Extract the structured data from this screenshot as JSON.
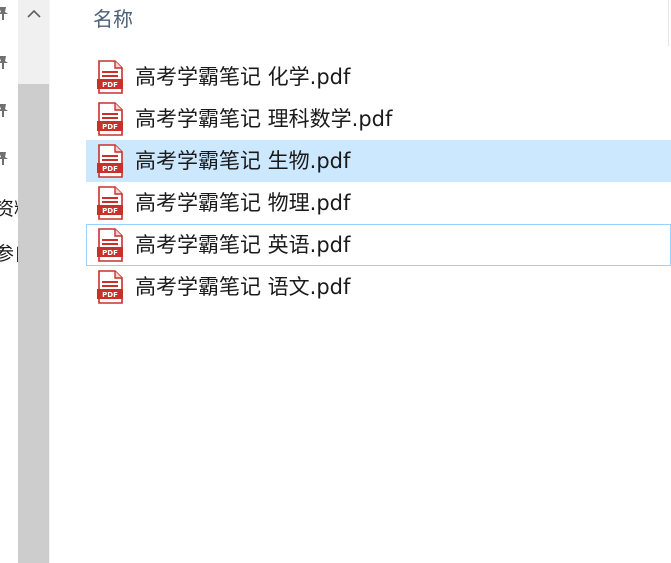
{
  "nav": {
    "partial_items": [
      {
        "text": "资料"
      },
      {
        "text": "参自"
      }
    ]
  },
  "list_header": {
    "name_column": "名称"
  },
  "files": [
    {
      "name": "高考学霸笔记 化学.pdf",
      "icon": "pdf-file-icon",
      "state": "normal"
    },
    {
      "name": "高考学霸笔记 理科数学.pdf",
      "icon": "pdf-file-icon",
      "state": "normal"
    },
    {
      "name": "高考学霸笔记 生物.pdf",
      "icon": "pdf-file-icon",
      "state": "selected"
    },
    {
      "name": "高考学霸笔记 物理.pdf",
      "icon": "pdf-file-icon",
      "state": "normal"
    },
    {
      "name": "高考学霸笔记 英语.pdf",
      "icon": "pdf-file-icon",
      "state": "focused"
    },
    {
      "name": "高考学霸笔记 语文.pdf",
      "icon": "pdf-file-icon",
      "state": "normal"
    }
  ],
  "icon_labels": {
    "pdf": "PDF"
  },
  "colors": {
    "selection_bg": "#cce8ff",
    "focus_border": "#99d1ff",
    "pdf_red": "#c9302c",
    "header_text": "#4c607a"
  }
}
